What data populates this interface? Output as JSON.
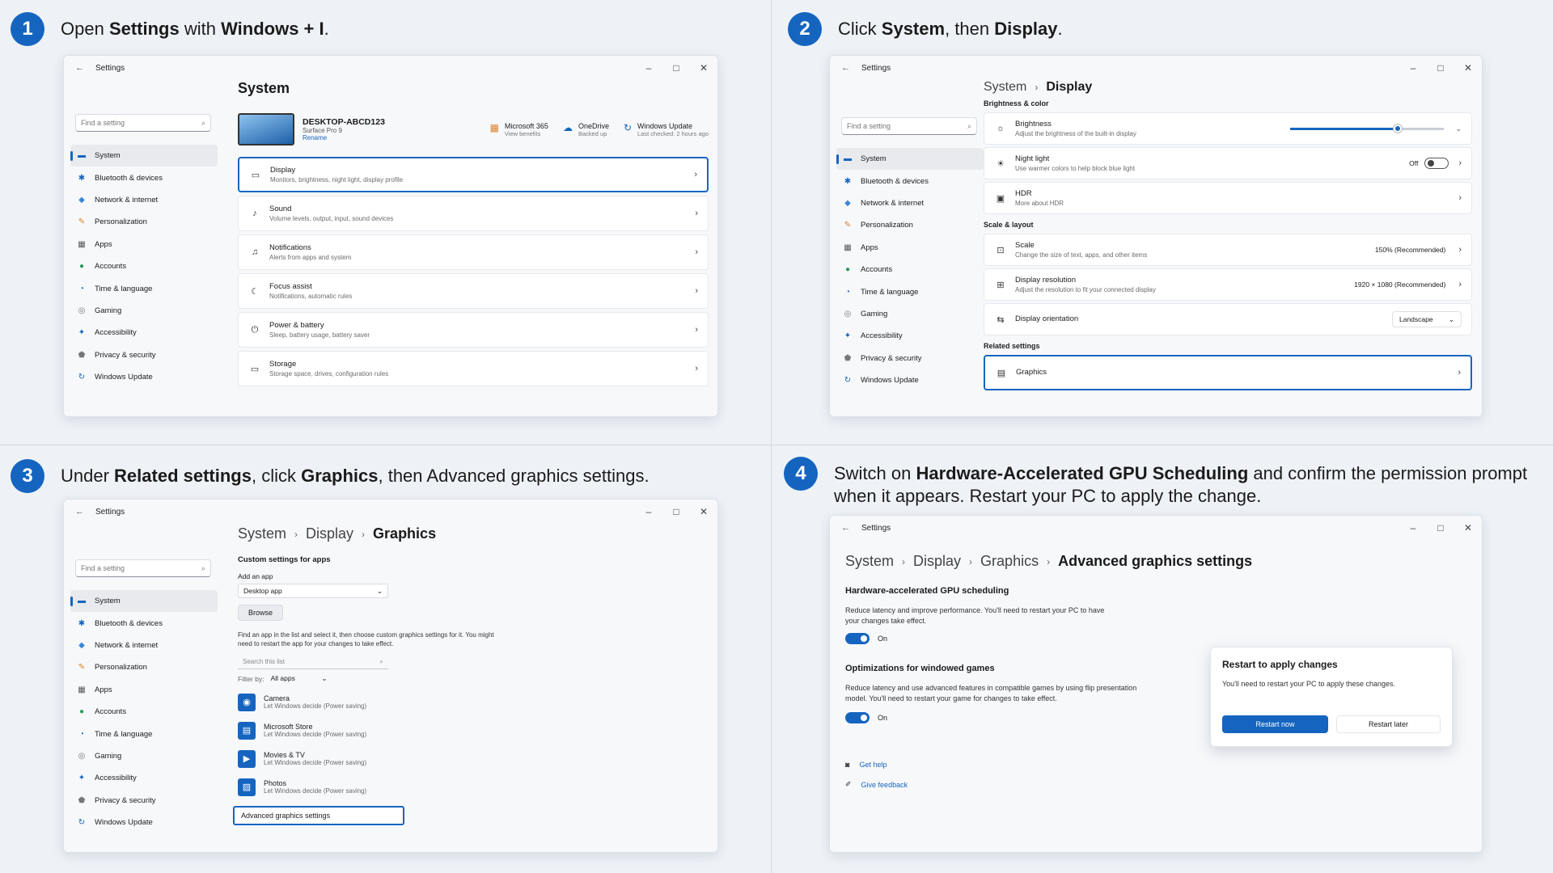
{
  "colors": {
    "accent": "#1565c0",
    "background": "#eef2f7",
    "window": "#f7f8fa"
  },
  "steps": [
    {
      "number": "1",
      "pre": "Open ",
      "b1": "Settings",
      "mid": " with ",
      "b2": "Windows + I",
      "post": "."
    },
    {
      "number": "2",
      "pre": "Click ",
      "b1": "System",
      "mid": ", then ",
      "b2": "Display",
      "post": "."
    },
    {
      "number": "3",
      "pre": "Under ",
      "b1": "Related settings",
      "mid": ", click ",
      "b2": "Graphics",
      "post": ", then Advanced graphics settings."
    },
    {
      "number": "4",
      "pre": "Switch on ",
      "b1": "Hardware-Accelerated GPU Scheduling",
      "post": " and confirm the permission prompt when it appears. Restart your PC to apply the change."
    }
  ],
  "window": {
    "title": "Settings",
    "back": "←",
    "min": "–",
    "max": "□",
    "close": "✕"
  },
  "search": {
    "placeholder": "Find a setting",
    "icon": "⌕"
  },
  "nav": [
    {
      "label": "System",
      "icon": "▬",
      "color": "#1565c0"
    },
    {
      "label": "Bluetooth & devices",
      "icon": "✱",
      "color": "#1565c0"
    },
    {
      "label": "Network & internet",
      "icon": "◆",
      "color": "#3a86d6"
    },
    {
      "label": "Personalization",
      "icon": "✎",
      "color": "#d9822b"
    },
    {
      "label": "Apps",
      "icon": "▦",
      "color": "#555"
    },
    {
      "label": "Accounts",
      "icon": "●",
      "color": "#2e9b5e"
    },
    {
      "label": "Time & language",
      "icon": "◔",
      "color": "#1565c0"
    },
    {
      "label": "Gaming",
      "icon": "◎",
      "color": "#777"
    },
    {
      "label": "Accessibility",
      "icon": "✦",
      "color": "#1565c0"
    },
    {
      "label": "Privacy & security",
      "icon": "⬟",
      "color": "#777"
    },
    {
      "label": "Windows Update",
      "icon": "↻",
      "color": "#1565c0"
    }
  ],
  "s1": {
    "title": "System",
    "device": {
      "name": "DESKTOP-ABCD123",
      "model": "Surface Pro 9",
      "rename": "Rename"
    },
    "status": [
      {
        "title": "Microsoft 365",
        "sub": "View benefits",
        "icon": "▦"
      },
      {
        "title": "OneDrive",
        "sub": "Backed up",
        "icon": "☁"
      },
      {
        "title": "Windows Update",
        "sub": "Last checked: 2 hours ago",
        "icon": "↻"
      }
    ],
    "cards": [
      {
        "title": "Display",
        "sub": "Monitors, brightness, night light, display profile",
        "icon": "▭"
      },
      {
        "title": "Sound",
        "sub": "Volume levels, output, input, sound devices",
        "icon": "♪"
      },
      {
        "title": "Notifications",
        "sub": "Alerts from apps and system",
        "icon": "♫"
      },
      {
        "title": "Focus assist",
        "sub": "Notifications, automatic rules",
        "icon": "☾"
      },
      {
        "title": "Power & battery",
        "sub": "Sleep, battery usage, battery saver",
        "icon": "⏻"
      },
      {
        "title": "Storage",
        "sub": "Storage space, drives, configuration rules",
        "icon": "▭"
      }
    ],
    "chev": "›"
  },
  "s2": {
    "crumb": [
      "System",
      "Display"
    ],
    "sec1": "Brightness & color",
    "brightness": {
      "title": "Brightness",
      "sub": "Adjust the brightness of the built-in display",
      "level": 0.7
    },
    "night": {
      "title": "Night light",
      "sub": "Use warmer colors to help block blue light",
      "value": "Off"
    },
    "hdr": {
      "title": "HDR",
      "link": "More about HDR"
    },
    "sec2": "Scale & layout",
    "scale": {
      "title": "Scale",
      "sub": "Change the size of text, apps, and other items",
      "value": "150% (Recommended)"
    },
    "res": {
      "title": "Display resolution",
      "sub": "Adjust the resolution to fit your connected display",
      "value": "1920 × 1080 (Recommended)"
    },
    "orient": {
      "title": "Display orientation",
      "value": "Landscape"
    },
    "sec3": "Related settings",
    "graphics": "Graphics"
  },
  "s3": {
    "crumb": [
      "System",
      "Display",
      "Graphics"
    ],
    "custom": "Custom settings for apps",
    "add_label": "Add an app",
    "dropdown": "Desktop app",
    "browse": "Browse",
    "help": "Find an app in the list and select it, then choose custom graphics settings for it. You might need to restart the app for your changes to take effect.",
    "search_list": "Search this list",
    "filter_label": "Filter by:",
    "filter_value": "All apps",
    "apps": [
      {
        "name": "Camera",
        "sub": "Let Windows decide (Power saving)",
        "icon": "◉"
      },
      {
        "name": "Microsoft Store",
        "sub": "Let Windows decide (Power saving)",
        "icon": "▤"
      },
      {
        "name": "Movies & TV",
        "sub": "Let Windows decide (Power saving)",
        "icon": "▶"
      },
      {
        "name": "Photos",
        "sub": "Let Windows decide (Power saving)",
        "icon": "▨"
      }
    ],
    "adv_link": "Advanced graphics settings"
  },
  "s4": {
    "crumb": [
      "System",
      "Display",
      "Graphics",
      "Advanced graphics settings"
    ],
    "hags_title": "Hardware-accelerated GPU scheduling",
    "hags_desc": "Reduce latency and improve performance. You'll need to restart your PC to have your changes take effect.",
    "hags_state": "On",
    "win_title": "Optimizations for windowed games",
    "win_desc": "Reduce latency and use advanced features in compatible games by using flip presentation model. You'll need to restart your game for changes to take effect.",
    "win_state": "On",
    "help": "Get help",
    "feedback": "Give feedback",
    "dialog": {
      "title": "Restart to apply changes",
      "body": "You'll need to restart your PC to apply these changes.",
      "primary": "Restart now",
      "secondary": "Restart later"
    }
  }
}
